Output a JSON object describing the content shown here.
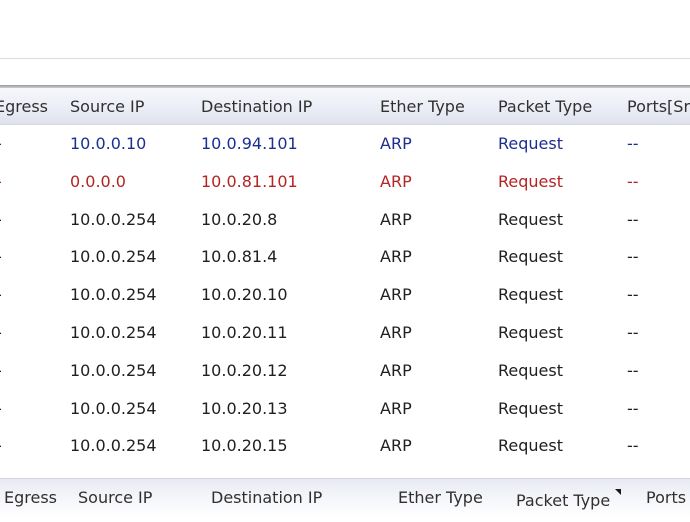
{
  "table": {
    "columns": [
      "Egress",
      "Source IP",
      "Destination IP",
      "Ether Type",
      "Packet Type",
      "Ports[Sr"
    ],
    "rows": [
      {
        "style": "blue",
        "cells": [
          "-",
          "10.0.0.10",
          "10.0.94.101",
          "ARP",
          "Request",
          "--"
        ]
      },
      {
        "style": "red",
        "cells": [
          "-",
          "0.0.0.0",
          "10.0.81.101",
          "ARP",
          "Request",
          "--"
        ]
      },
      {
        "style": "normal",
        "cells": [
          "-",
          "10.0.0.254",
          "10.0.20.8",
          "ARP",
          "Request",
          "--"
        ]
      },
      {
        "style": "normal",
        "cells": [
          "-",
          "10.0.0.254",
          "10.0.81.4",
          "ARP",
          "Request",
          "--"
        ]
      },
      {
        "style": "normal",
        "cells": [
          "-",
          "10.0.0.254",
          "10.0.20.10",
          "ARP",
          "Request",
          "--"
        ]
      },
      {
        "style": "normal",
        "cells": [
          "-",
          "10.0.0.254",
          "10.0.20.11",
          "ARP",
          "Request",
          "--"
        ]
      },
      {
        "style": "normal",
        "cells": [
          "-",
          "10.0.0.254",
          "10.0.20.12",
          "ARP",
          "Request",
          "--"
        ]
      },
      {
        "style": "normal",
        "cells": [
          "-",
          "10.0.0.254",
          "10.0.20.13",
          "ARP",
          "Request",
          "--"
        ]
      },
      {
        "style": "normal",
        "cells": [
          "-",
          "10.0.0.254",
          "10.0.20.15",
          "ARP",
          "Request",
          "--"
        ]
      }
    ]
  },
  "footer": {
    "columns": [
      "Egress",
      "Source IP",
      "Destination IP",
      "Ether Type",
      "Packet Type",
      "Ports"
    ]
  },
  "colors": {
    "highlight_blue": "#1c2f8e",
    "highlight_red": "#b52323",
    "text": "#202020"
  }
}
